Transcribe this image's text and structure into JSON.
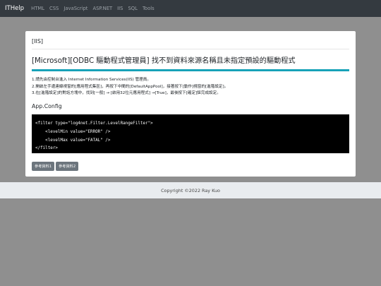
{
  "navbar": {
    "brand": "ITHelp",
    "links": [
      "HTML",
      "CSS",
      "JavaScript",
      "ASP.NET",
      "IIS",
      "SQL",
      "Tools"
    ]
  },
  "article": {
    "tag": "[IIS]",
    "title": "[Microsoft][ODBC 驅動程式管理員] 找不到資料來源名稱且未指定預設的驅動程式",
    "steps": [
      "1.請先由控制台進入 Internet Information Services(IIS) 管理員。",
      "2.開啟左手邊連線視窗的[應用程式集區]，再按下中間的[DefaultAppPool]，接著按下[動作]視窗的[進階設定]。",
      "3.在[進階設定]的對話方塊中，找到[一般] → [啟用32位元應用程式] →[True]，最後按下[確定]鈕完成設定。"
    ],
    "section_title": "App.Config",
    "code_lines": [
      "<filter type=\"log4net.Filter.LevelRangeFilter\">",
      "    <levelMin value=\"ERROR\" />",
      "    <levelMax value=\"FATAL\" />",
      "</filter>"
    ],
    "buttons": [
      "參考資料1",
      "參考資料2"
    ]
  },
  "footer": {
    "copyright": "Copyright ©2022 Ray Kuo"
  }
}
